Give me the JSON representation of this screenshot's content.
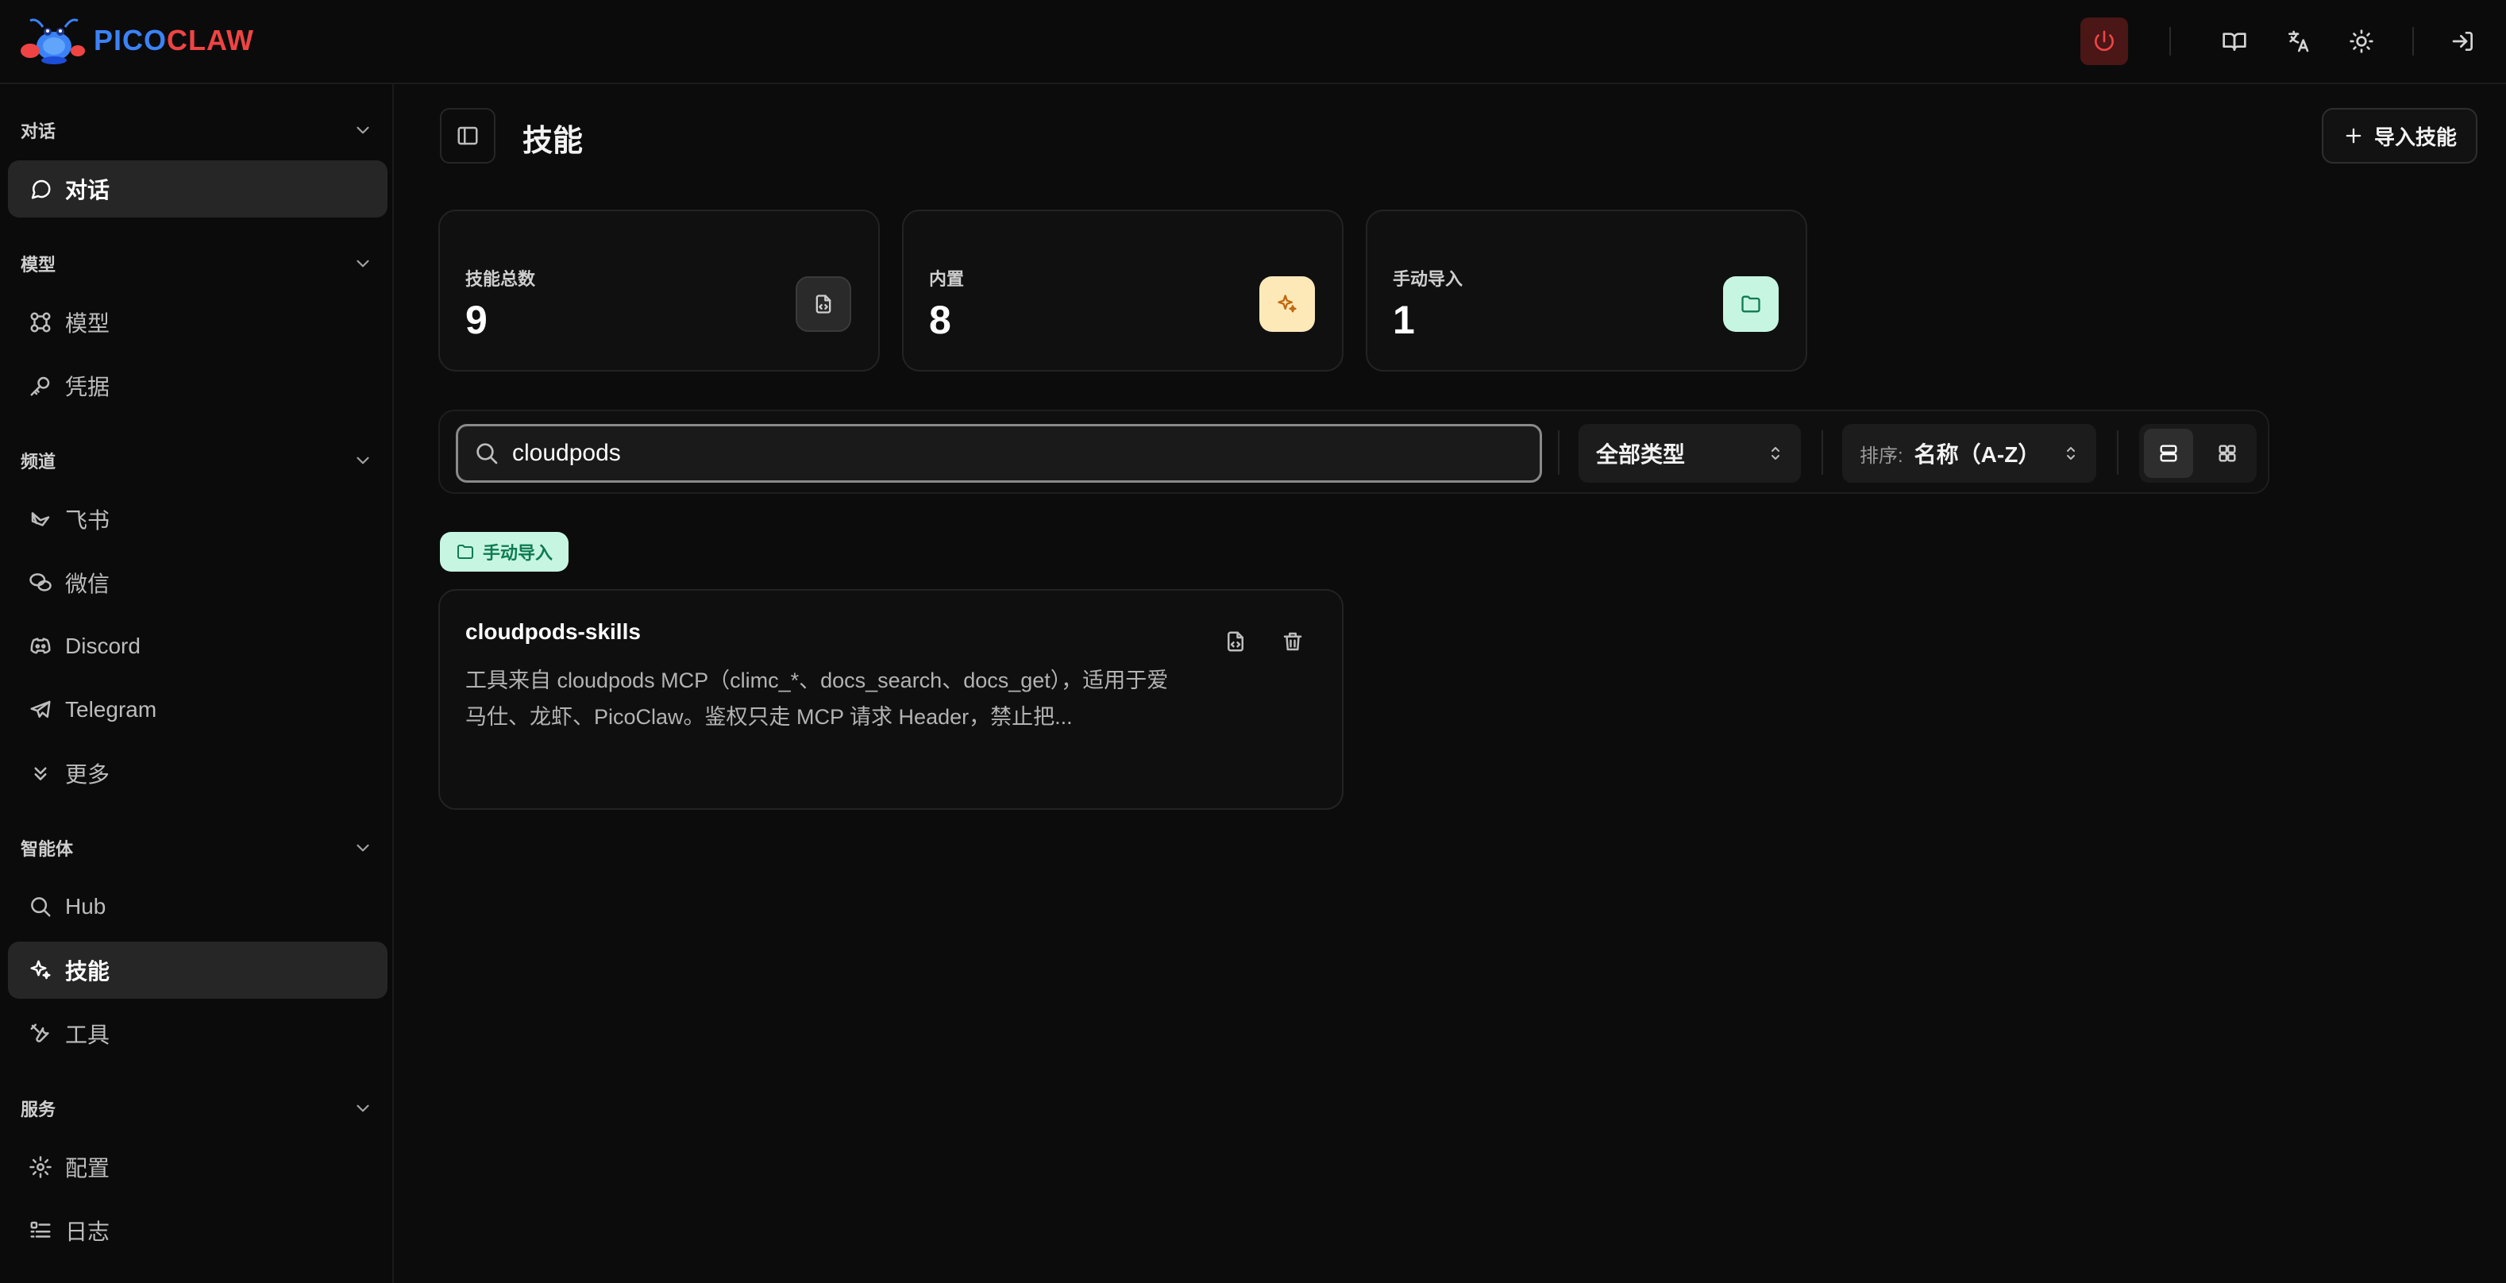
{
  "brand": {
    "name_left": "PICO",
    "name_right": "CLAW"
  },
  "sidebar": {
    "sections": [
      {
        "title": "对话",
        "items": [
          {
            "label": "对话",
            "icon": "message-icon",
            "active": false
          }
        ]
      },
      {
        "title": "模型",
        "items": [
          {
            "label": "模型",
            "icon": "model-icon"
          },
          {
            "label": "凭据",
            "icon": "key-icon"
          }
        ]
      },
      {
        "title": "频道",
        "items": [
          {
            "label": "飞书",
            "icon": "feishu-icon"
          },
          {
            "label": "微信",
            "icon": "wechat-icon"
          },
          {
            "label": "Discord",
            "icon": "discord-icon"
          },
          {
            "label": "Telegram",
            "icon": "telegram-icon"
          },
          {
            "label": "更多",
            "icon": "chevrons-down-icon"
          }
        ]
      },
      {
        "title": "智能体",
        "items": [
          {
            "label": "Hub",
            "icon": "search-icon"
          },
          {
            "label": "技能",
            "icon": "sparkles-icon",
            "active": true
          },
          {
            "label": "工具",
            "icon": "tools-icon"
          }
        ]
      },
      {
        "title": "服务",
        "items": [
          {
            "label": "配置",
            "icon": "gear-icon"
          },
          {
            "label": "日志",
            "icon": "list-icon"
          }
        ]
      }
    ]
  },
  "header": {
    "title": "技能",
    "import_label": "导入技能"
  },
  "stats": [
    {
      "label": "技能总数",
      "value": "9",
      "icon": "file-code-icon",
      "color": "#2a2a2a"
    },
    {
      "label": "内置",
      "value": "8",
      "icon": "sparkles-icon",
      "color": "#fde9b8"
    },
    {
      "label": "手动导入",
      "value": "1",
      "icon": "folder-icon",
      "color": "#c6f6e2"
    }
  ],
  "filters": {
    "search_value": "cloudpods",
    "type_select": "全部类型",
    "sort_prefix": "排序:",
    "sort_value": "名称（A-Z）"
  },
  "group": {
    "label": "手动导入"
  },
  "skills": [
    {
      "name": "cloudpods-skills",
      "description": "工具来自 cloudpods MCP（climc_*、docs_search、docs_get），适用于爱马仕、龙虾、PicoClaw。鉴权只走 MCP 请求 Header，禁止把..."
    }
  ],
  "colors": {
    "accent_blue": "#3b82f6",
    "accent_red": "#ef4444",
    "badge_green": "#c6f6e2"
  }
}
